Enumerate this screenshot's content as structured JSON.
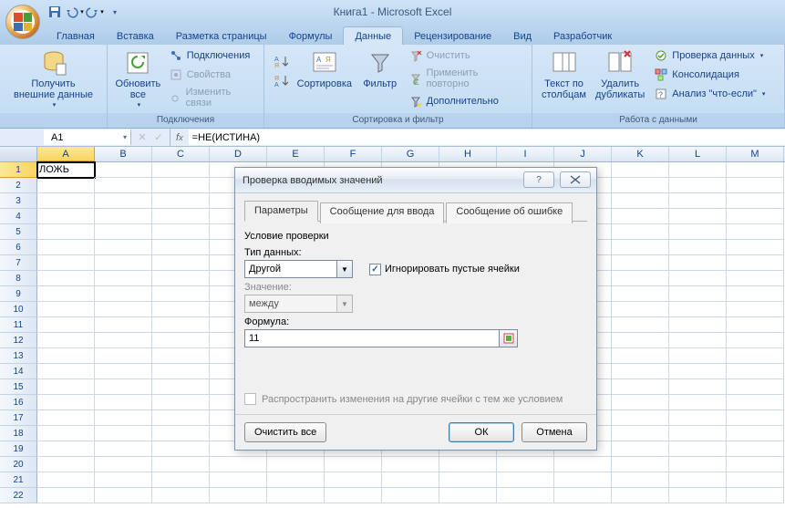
{
  "title": "Книга1  -  Microsoft Excel",
  "qat": {
    "save": "save-icon",
    "undo": "undo-icon",
    "redo": "redo-icon"
  },
  "tabs": {
    "items": [
      "Главная",
      "Вставка",
      "Разметка страницы",
      "Формулы",
      "Данные",
      "Рецензирование",
      "Вид",
      "Разработчик"
    ],
    "active": 4
  },
  "ribbon": {
    "groups": {
      "external": {
        "label": "",
        "get_data": "Получить\nвнешние данные"
      },
      "connections": {
        "label": "Подключения",
        "refresh": "Обновить\nвсе",
        "conn": "Подключения",
        "props": "Свойства",
        "edit_links": "Изменить связи"
      },
      "sort_filter": {
        "label": "Сортировка и фильтр",
        "sort": "Сортировка",
        "filter": "Фильтр",
        "clear": "Очистить",
        "reapply": "Применить повторно",
        "advanced": "Дополнительно"
      },
      "data_tools": {
        "label": "Работа с данными",
        "text_cols": "Текст по\nстолбцам",
        "remove_dup": "Удалить\nдубликаты",
        "validation": "Проверка данных",
        "consolidate": "Консолидация",
        "whatif": "Анализ \"что-если\""
      }
    }
  },
  "namebox": "A1",
  "formula": "=НЕ(ИСТИНА)",
  "columns": [
    "A",
    "B",
    "C",
    "D",
    "E",
    "F",
    "G",
    "H",
    "I",
    "J",
    "K",
    "L",
    "M"
  ],
  "cellA1": "ЛОЖЬ",
  "dialog": {
    "title": "Проверка вводимых значений",
    "tabs": [
      "Параметры",
      "Сообщение для ввода",
      "Сообщение об ошибке"
    ],
    "group_title": "Условие проверки",
    "type_label": "Тип данных:",
    "type_value": "Другой",
    "ignore_blank": "Игнорировать пустые ячейки",
    "value_label": "Значение:",
    "value_value": "между",
    "formula_label": "Формула:",
    "formula_value": "11",
    "spread": "Распространить изменения на другие ячейки с тем же условием",
    "clear_all": "Очистить все",
    "ok": "ОК",
    "cancel": "Отмена"
  }
}
